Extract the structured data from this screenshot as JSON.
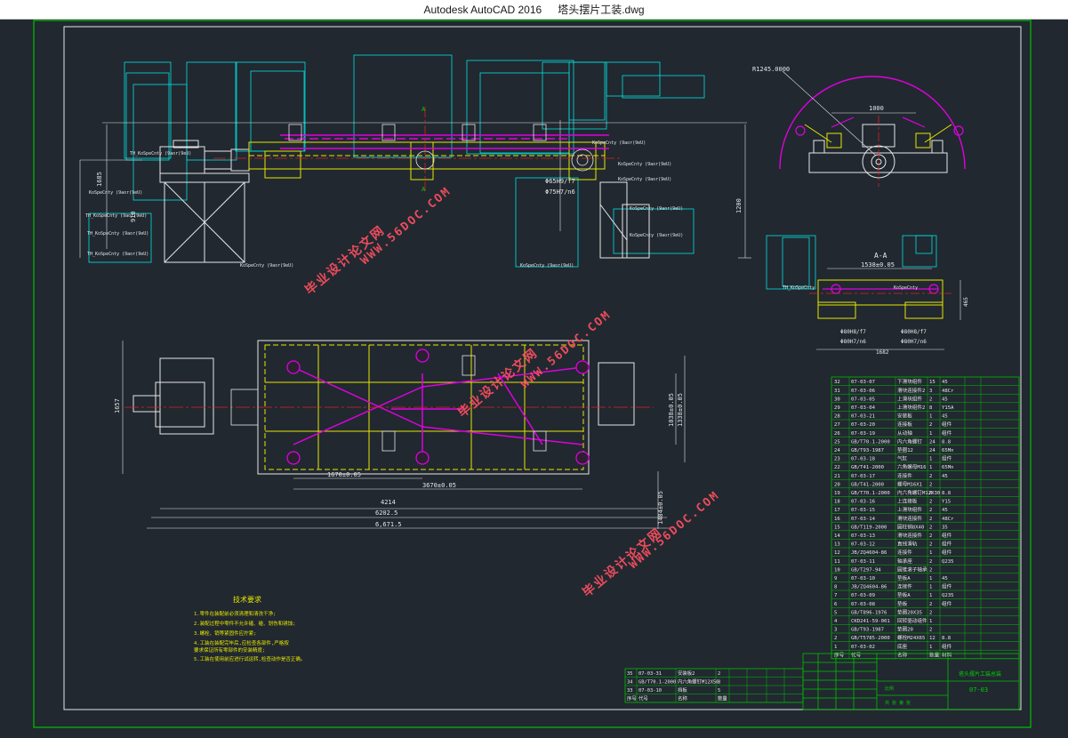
{
  "titlebar": {
    "app_name": "Autodesk AutoCAD 2016",
    "file_name": "塔头摆片工装.dwg"
  },
  "colors": {
    "background": "#212830",
    "frame": "#ffffff",
    "border": "#00c000",
    "drawing_white": "#e6e6e6",
    "cyan": "#00e0e0",
    "yellow": "#e6e600",
    "magenta": "#e000e0",
    "red": "#e02020",
    "green": "#00d000",
    "watermark": "#ff5060"
  },
  "watermarks": {
    "site": "WWW.56DOC.COM",
    "cn": "毕业设计论文网"
  },
  "dimensions": {
    "radius": "R1245.0000",
    "d1000": "1000",
    "d1685": "1685",
    "d910": "910",
    "d1200": "1200",
    "d1538": "1538±0.05",
    "d465": "465",
    "d1682": "1682",
    "fit1": "Φ65H9/f7",
    "fit2": "Φ75H7/n6",
    "fit3": "Φ80H8/f7",
    "fit4": "Φ80H7/n6",
    "d1670": "1670±0.05",
    "d3670": "3670±0.05",
    "d4214": "4214",
    "d6202": "6202.5",
    "d6671": "6,671.5",
    "d1657": "1657",
    "d1038": "1038±0.05",
    "d1338": "1338±0.05",
    "d1484": "1484±0.05",
    "section_label": "A-A",
    "section_a": "A"
  },
  "notes": {
    "title": "技术要求",
    "lines": [
      "1.零件在装配前必须清理和清洗干净;",
      "2.装配过程中零件不允许磕、碰、划伤和锈蚀;",
      "3.螺栓、销等紧固件应拧紧;",
      "4.工装在装配完毕后,应检查各部件,严格按",
      "  要求保证所有零部件的安装精度;",
      "5.工装在使用前应进行试运转,检查动作是否正确。"
    ]
  },
  "bom": {
    "rows": [
      [
        "32",
        "07-03-07",
        "下滑块组件",
        "15",
        "45"
      ],
      [
        "31",
        "07-03-06",
        "滑块连接件2",
        "3",
        "48Cr"
      ],
      [
        "30",
        "07-03-05",
        "上滑块组件",
        "2",
        "45"
      ],
      [
        "29",
        "07-03-04",
        "上滑块组件2",
        "8",
        "Y15A"
      ],
      [
        "28",
        "07-03-21",
        "安装板",
        "1",
        "45"
      ],
      [
        "27",
        "07-03-20",
        "连接板",
        "2",
        "组件"
      ],
      [
        "26",
        "07-03-19",
        "从动轴",
        "1",
        "组件"
      ],
      [
        "25",
        "GB/T70.1-2000",
        "内六角螺钉",
        "24",
        "8.8"
      ],
      [
        "24",
        "GB/T93-1987",
        "垫圈12",
        "24",
        "65Mn"
      ],
      [
        "23",
        "07-03-18",
        "气缸",
        "1",
        "组件"
      ],
      [
        "22",
        "GB/T41-2000",
        "六角螺母M16",
        "1",
        "65Mn"
      ],
      [
        "21",
        "07-03-17",
        "连接件",
        "2",
        "45"
      ],
      [
        "20",
        "GB/T41-2000",
        "螺母M16X1",
        "2",
        ""
      ],
      [
        "19",
        "GB/T70.1-2000",
        "内六角螺钉M12X30",
        "8",
        "8.8"
      ],
      [
        "18",
        "07-03-16",
        "上连接板",
        "2",
        "Y15"
      ],
      [
        "17",
        "07-03-15",
        "上滑块组件",
        "2",
        "45"
      ],
      [
        "16",
        "07-03-14",
        "滑块连接件",
        "2",
        "48Cr"
      ],
      [
        "15",
        "GB/T119-2000",
        "圆柱销8X40",
        "2",
        "35"
      ],
      [
        "14",
        "07-03-13",
        "滑块连接件",
        "2",
        "组件"
      ],
      [
        "13",
        "07-03-12",
        "直线滑轨",
        "2",
        "组件"
      ],
      [
        "12",
        "JB/ZQ4604-86",
        "连接件",
        "1",
        "组件"
      ],
      [
        "11",
        "07-03-11",
        "轴承座",
        "2",
        "Q235"
      ],
      [
        "10",
        "GB/T297-94",
        "圆锥滚子轴承",
        "2",
        ""
      ],
      [
        "9",
        "07-03-10",
        "垫板A",
        "1",
        "45"
      ],
      [
        "8",
        "JB/ZQ4604-86",
        "连接件",
        "1",
        "组件"
      ],
      [
        "7",
        "07-03-09",
        "垫板A",
        "1",
        "Q235"
      ],
      [
        "6",
        "07-03-08",
        "垫板",
        "2",
        "组件"
      ],
      [
        "5",
        "GB/T896-1976",
        "垫圈20X35",
        "2",
        ""
      ],
      [
        "4",
        "CKD241-59-001",
        "回转驱动组件",
        "1",
        ""
      ],
      [
        "3",
        "GB/T93-1987",
        "垫圈20",
        "2",
        ""
      ],
      [
        "2",
        "GB/T5785-2000",
        "螺栓M24X65",
        "12",
        "8.8"
      ],
      [
        "1",
        "07-03-02",
        "底座",
        "1",
        "组件"
      ]
    ],
    "header": [
      "序号",
      "代号",
      "名称",
      "数量",
      "材料"
    ],
    "lower_rows": [
      [
        "35",
        "07-03-31",
        "安装板2",
        "2"
      ],
      [
        "34",
        "GB/T70.1-2000",
        "内六角螺钉M12X50",
        "8"
      ],
      [
        "33",
        "07-03-10",
        "挡板",
        "5"
      ]
    ]
  },
  "titleblock": {
    "drawing_name": "塔头摆片工装总装",
    "drawing_no": "07-03",
    "scale_label": "比例",
    "sheet": "共 张 第 张"
  }
}
